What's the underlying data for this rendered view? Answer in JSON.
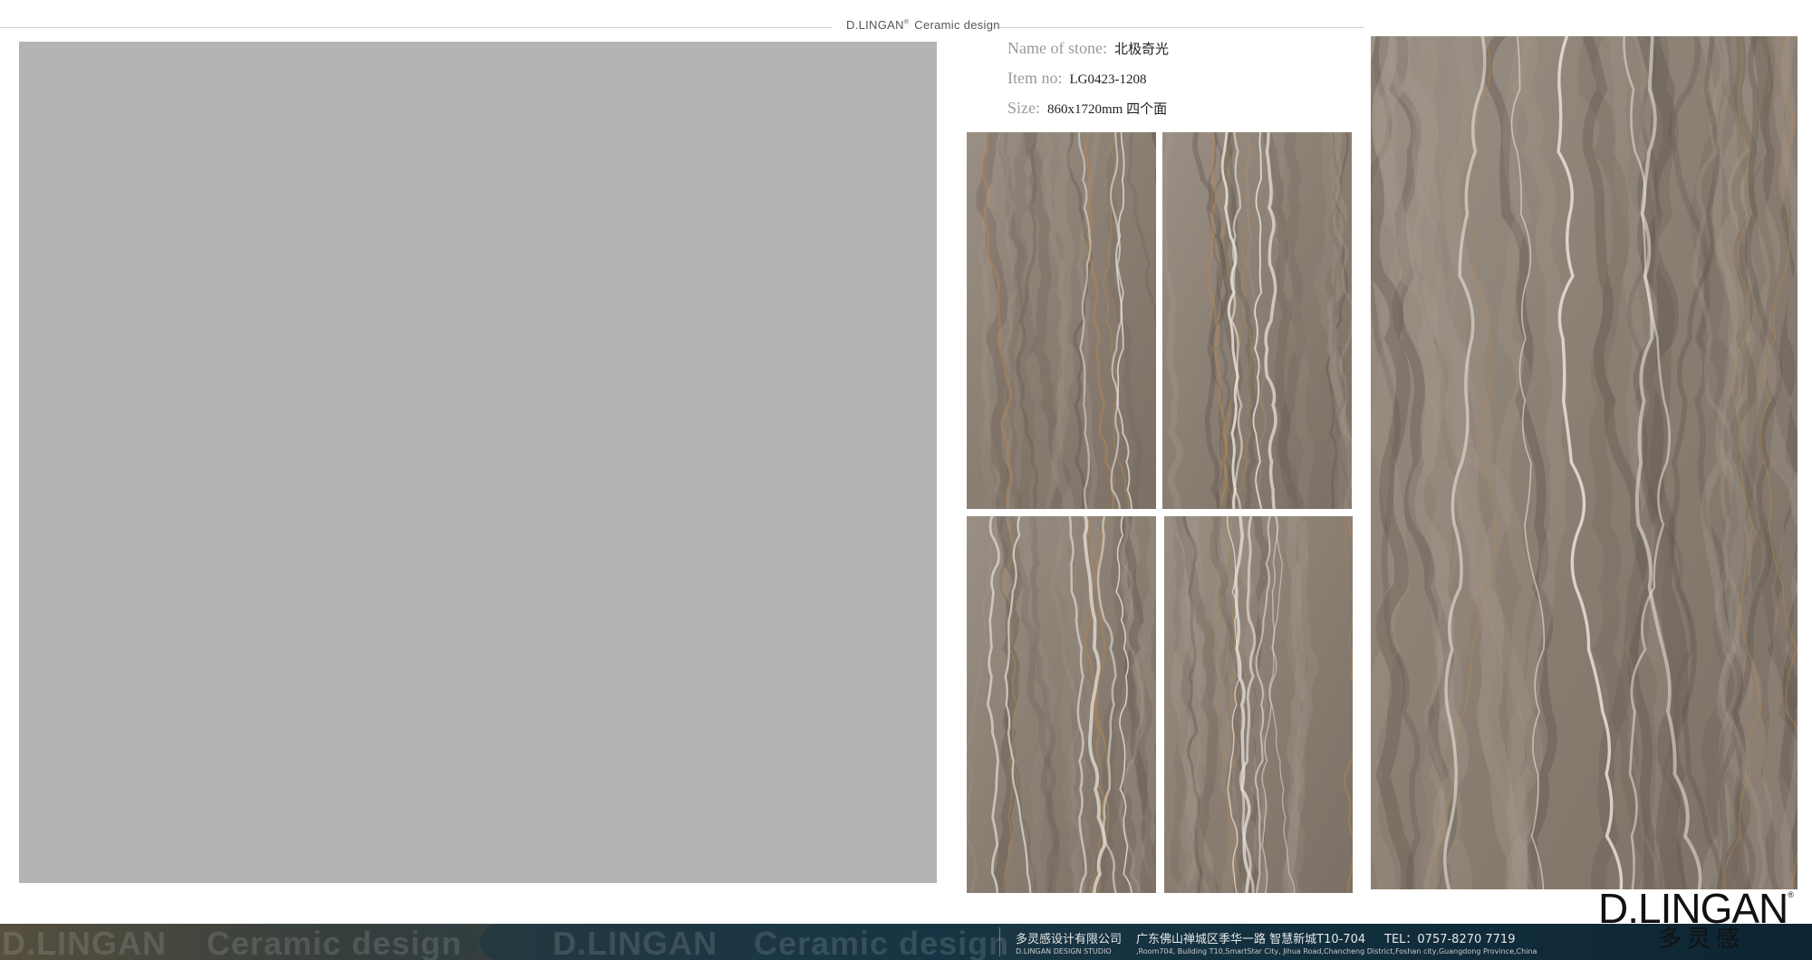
{
  "header": {
    "brand": "D.LINGAN",
    "reg_mark": "®",
    "subtitle": "Ceramic design"
  },
  "stone_info": {
    "name_label": "Name  of stone:",
    "name_value": "北极奇光",
    "item_label": "Item no:",
    "item_value": "LG0423-1208",
    "size_label": "Size:",
    "size_value": "860x1720mm  四个面"
  },
  "tiles": [
    {
      "name": "tile-face-1",
      "seed": 1
    },
    {
      "name": "tile-face-2",
      "seed": 2
    },
    {
      "name": "tile-face-3",
      "seed": 3
    },
    {
      "name": "tile-face-4",
      "seed": 4
    },
    {
      "name": "tile-large-preview",
      "seed": 5
    }
  ],
  "footer": {
    "ghost_brand": "D.LINGAN",
    "ghost_subtitle": "Ceramic design",
    "company_cn": "多灵感设计有限公司",
    "address_cn": "广东佛山禅城区季华一路  智慧新城T10-704",
    "tel": "TEL：0757-8270 7719",
    "studio_en": "D.LINGAN DESIGN STUDIO",
    "address_en": ",Room704, Building T10,SmartStar City, Jihua Road,Chancheng  District,Foshan  city,Guangdong Province,China"
  },
  "logo": {
    "text": "D.LINGAN",
    "reg_mark": "®",
    "cn": "多灵感"
  },
  "colors": {
    "marble_base": "#8a7e72",
    "marble_vein_light": "#e6e1da",
    "marble_vein_dark": "#5a5048",
    "marble_vein_gold": "#b8884e",
    "placeholder_gray": "#b4b4b4"
  }
}
